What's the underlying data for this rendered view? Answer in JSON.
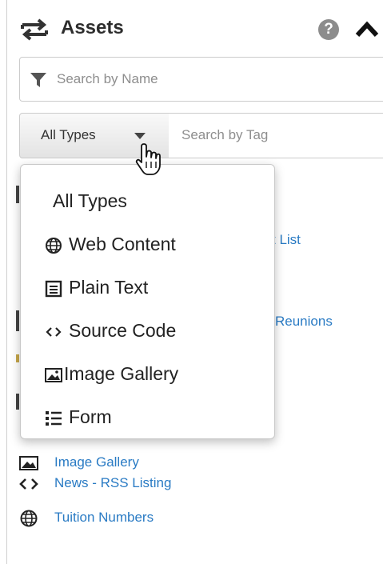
{
  "panel": {
    "title": "Assets",
    "help_icon": "question-circle-icon",
    "collapse_icon": "chevron-up-icon",
    "header_icon": "swap-arrows-icon"
  },
  "search": {
    "name_placeholder": "Search by Name",
    "tag_placeholder": "Search by Tag",
    "filter_icon": "filter-icon"
  },
  "type_filter": {
    "selected": "All Types",
    "options": [
      {
        "label": "All Types",
        "icon": ""
      },
      {
        "label": "Web Content",
        "icon": "globe-icon"
      },
      {
        "label": "Plain Text",
        "icon": "document-icon"
      },
      {
        "label": "Source Code",
        "icon": "code-icon"
      },
      {
        "label": "Image Gallery",
        "icon": "image-icon"
      },
      {
        "label": "Form",
        "icon": "list-icon"
      }
    ]
  },
  "hidden_partial_items": [
    "t List",
    "Reunions"
  ],
  "assets": [
    {
      "label": "Image Gallery",
      "icon": "image-icon"
    },
    {
      "label": "News - RSS Listing",
      "icon": "code-icon"
    },
    {
      "label": "Tuition Numbers",
      "icon": "globe-icon"
    }
  ],
  "colors": {
    "link": "#2a7bc4",
    "text": "#222222",
    "border": "#cccccc"
  }
}
